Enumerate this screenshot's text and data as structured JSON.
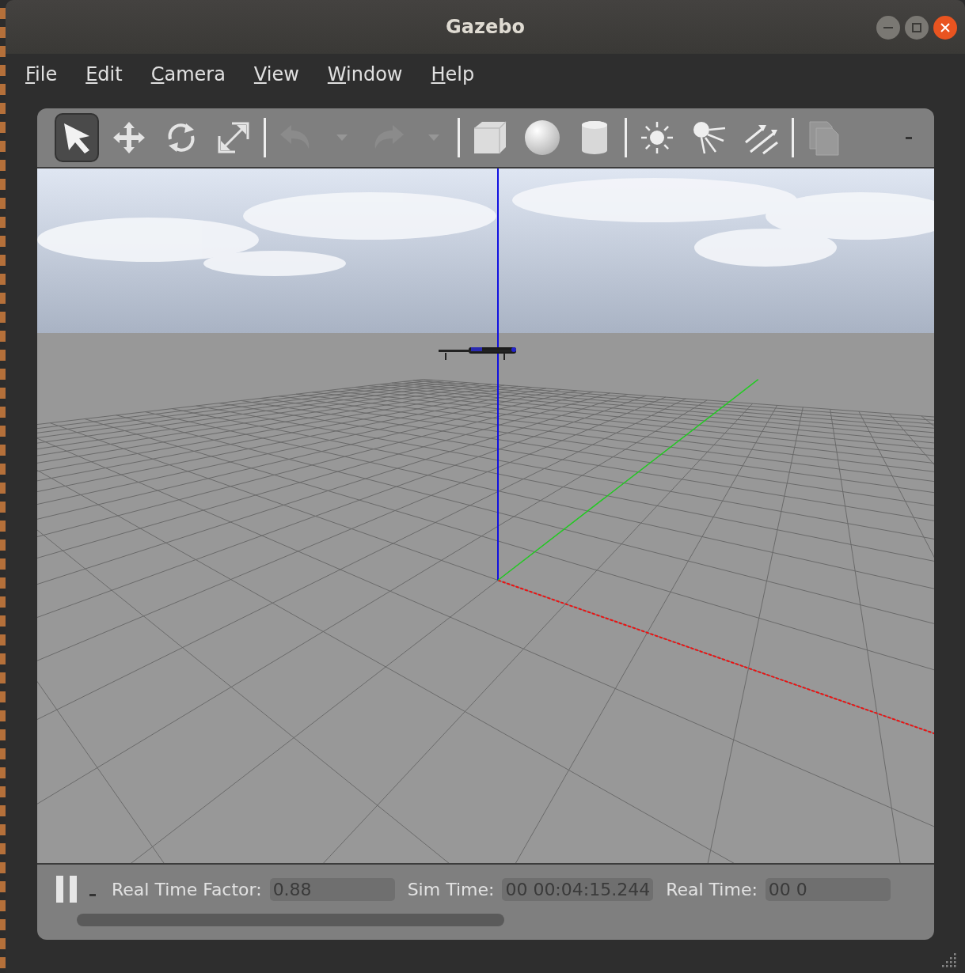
{
  "window": {
    "title": "Gazebo"
  },
  "menu": [
    "File",
    "Edit",
    "Camera",
    "View",
    "Window",
    "Help"
  ],
  "toolbar": [
    {
      "kind": "select",
      "selected": true
    },
    {
      "kind": "translate",
      "selected": false
    },
    {
      "kind": "rotate",
      "selected": false
    },
    {
      "kind": "scale",
      "selected": false
    },
    {
      "kind": "separator"
    },
    {
      "kind": "undo",
      "disabled": true
    },
    {
      "kind": "dropdown",
      "disabled": true
    },
    {
      "kind": "redo",
      "disabled": true
    },
    {
      "kind": "dropdown",
      "disabled": true
    },
    {
      "kind": "separator"
    },
    {
      "kind": "box"
    },
    {
      "kind": "sphere"
    },
    {
      "kind": "cylinder"
    },
    {
      "kind": "separator"
    },
    {
      "kind": "pointlight"
    },
    {
      "kind": "spotlight"
    },
    {
      "kind": "dirlight"
    },
    {
      "kind": "separator"
    },
    {
      "kind": "copy",
      "disabled": true
    }
  ],
  "status_bar": {
    "paused": false,
    "fields": [
      {
        "label": "Real Time Factor:",
        "value": "0.88"
      },
      {
        "label": "Sim Time:",
        "value": "00 00:04:15.244"
      },
      {
        "label": "Real Time:",
        "value": "00 0"
      }
    ]
  }
}
